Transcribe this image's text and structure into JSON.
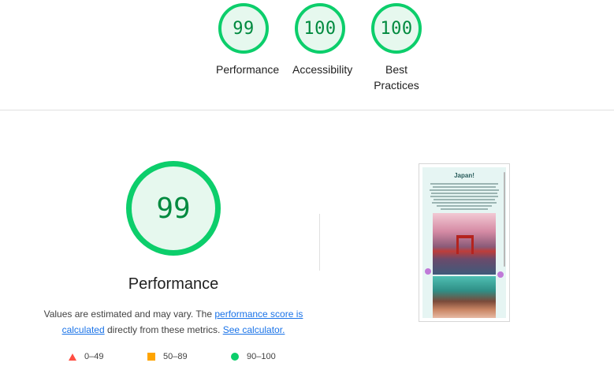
{
  "category_gauges": [
    {
      "score": "99",
      "label": "Performance",
      "color": "#0cce6b"
    },
    {
      "score": "100",
      "label": "Accessibility",
      "color": "#0cce6b"
    },
    {
      "score": "100",
      "label": "Best Practices",
      "color": "#0cce6b"
    }
  ],
  "performance": {
    "score": "99",
    "title": "Performance",
    "desc_prefix": "Values are estimated and may vary. The ",
    "desc_link1": "performance score is calculated",
    "desc_middle": " directly from these metrics. ",
    "desc_link2": "See calculator."
  },
  "legend": {
    "fail": {
      "range": "0–49",
      "icon": "red-triangle-icon",
      "color": "#ff4e42"
    },
    "average": {
      "range": "50–89",
      "icon": "orange-square-icon",
      "color": "#ffa400"
    },
    "pass": {
      "range": "90–100",
      "icon": "green-circle-icon",
      "color": "#0cce6b"
    }
  },
  "screenshot": {
    "title": "Japan!"
  }
}
